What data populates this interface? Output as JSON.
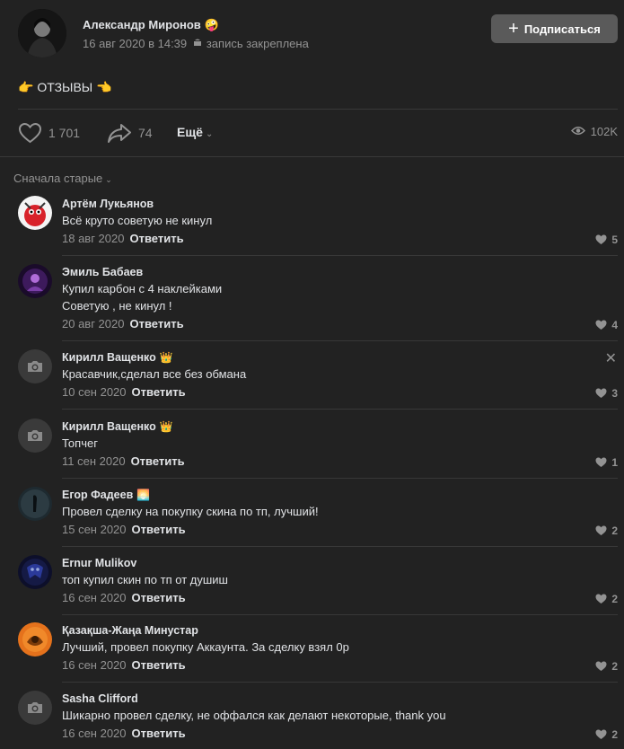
{
  "post": {
    "author": "Александр Миронов",
    "author_emoji": "🤪",
    "date": "16 авг 2020 в 14:39",
    "pinned": "запись закреплена",
    "subscribe_label": "Подписаться",
    "text": "👉 ОТЗЫВЫ 👈",
    "likes": "1 701",
    "shares": "74",
    "more_label": "Ещё",
    "views": "102K"
  },
  "sort": {
    "label": "Сначала старые"
  },
  "comments": [
    {
      "name": "Артём Лукьянов",
      "emoji": "",
      "text": [
        "Всё круто советую не кинул"
      ],
      "date": "18 авг 2020",
      "reply": "Ответить",
      "likes": "5",
      "avatar": "red"
    },
    {
      "name": "Эмиль Бабаев",
      "emoji": "",
      "text": [
        "Купил карбон с 4 наклейками",
        "Советую , не кинул !"
      ],
      "date": "20 авг 2020",
      "reply": "Ответить",
      "likes": "4",
      "avatar": "purple"
    },
    {
      "name": "Кирилл Ващенко",
      "emoji": "👑",
      "text": [
        "Красавчик,сделал все без обмана"
      ],
      "date": "10 сен 2020",
      "reply": "Ответить",
      "likes": "3",
      "avatar": "camera"
    },
    {
      "name": "Кирилл Ващенко",
      "emoji": "👑",
      "text": [
        "Топчег"
      ],
      "date": "11 сен 2020",
      "reply": "Ответить",
      "likes": "1",
      "avatar": "camera"
    },
    {
      "name": "Егор Фадеев",
      "emoji": "🌅",
      "text": [
        "Провел сделку на покупку скина по тп, лучший!"
      ],
      "date": "15 сен 2020",
      "reply": "Ответить",
      "likes": "2",
      "avatar": "dark"
    },
    {
      "name": "Ernur Mulikov",
      "emoji": "",
      "text": [
        "топ купил скин по тп от душиш"
      ],
      "date": "16 сен 2020",
      "reply": "Ответить",
      "likes": "2",
      "avatar": "blue"
    },
    {
      "name": "Қазақша-Жаңа Минустар",
      "emoji": "",
      "text": [
        "Лучший, провел покупку Аккаунта. За сделку взял 0р"
      ],
      "date": "16 сен 2020",
      "reply": "Ответить",
      "likes": "2",
      "avatar": "orange"
    },
    {
      "name": "Sasha Clifford",
      "emoji": "",
      "text": [
        "Шикарно провел сделку, не оффался как делают некоторые, thank you"
      ],
      "date": "16 сен 2020",
      "reply": "Ответить",
      "likes": "2",
      "avatar": "camera"
    }
  ],
  "colors": {
    "background": "#222222",
    "text": "#e1e3e6",
    "muted": "#939393",
    "button": "#5a5a5a",
    "divider": "#383838"
  },
  "icons": [
    "heart-icon",
    "share-icon",
    "eye-icon",
    "camera-icon",
    "close-icon",
    "plus-icon",
    "chevron-down-icon",
    "android-icon"
  ]
}
